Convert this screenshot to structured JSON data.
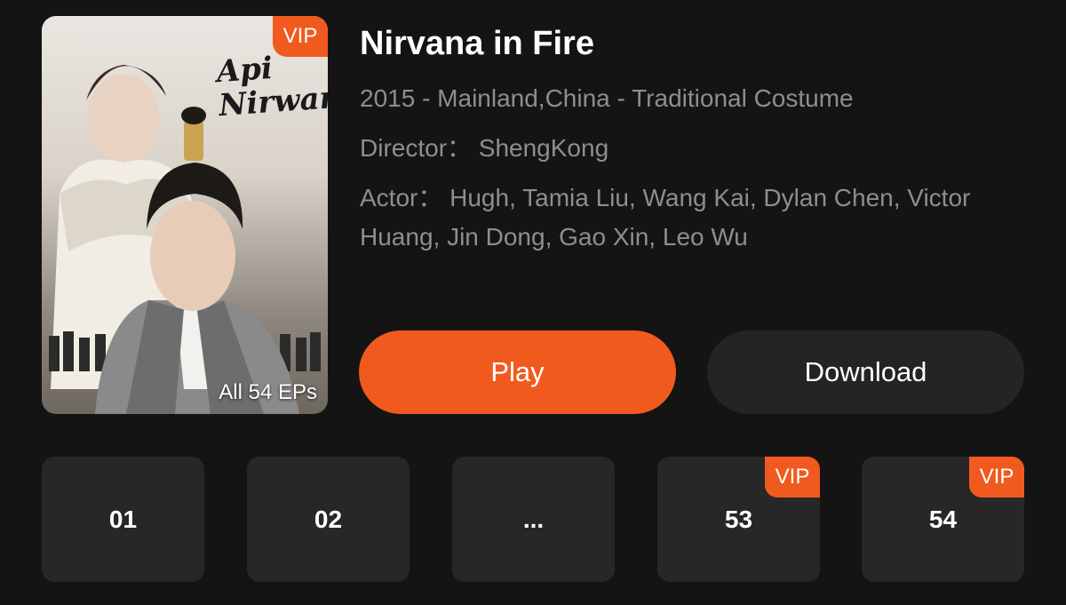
{
  "poster": {
    "badge": "VIP",
    "title_art": "Api Nirwana",
    "episode_count": "All 54 EPs"
  },
  "show": {
    "title": "Nirvana in Fire",
    "info_line": "2015 - Mainland,China - Traditional Costume",
    "director": "Director：  ShengKong",
    "actors": "Actor：  Hugh, Tamia Liu, Wang Kai, Dylan Chen, Victor Huang, Jin Dong, Gao Xin, Leo Wu"
  },
  "actions": {
    "play_label": "Play",
    "download_label": "Download"
  },
  "episodes": [
    {
      "label": "01",
      "badge": ""
    },
    {
      "label": "02",
      "badge": ""
    },
    {
      "label": "...",
      "badge": ""
    },
    {
      "label": "53",
      "badge": "VIP"
    },
    {
      "label": "54",
      "badge": "VIP"
    }
  ],
  "colors": {
    "accent": "#f05a1e",
    "background": "#141414",
    "tile": "#272727",
    "secondary_text": "#8e8e8e"
  }
}
